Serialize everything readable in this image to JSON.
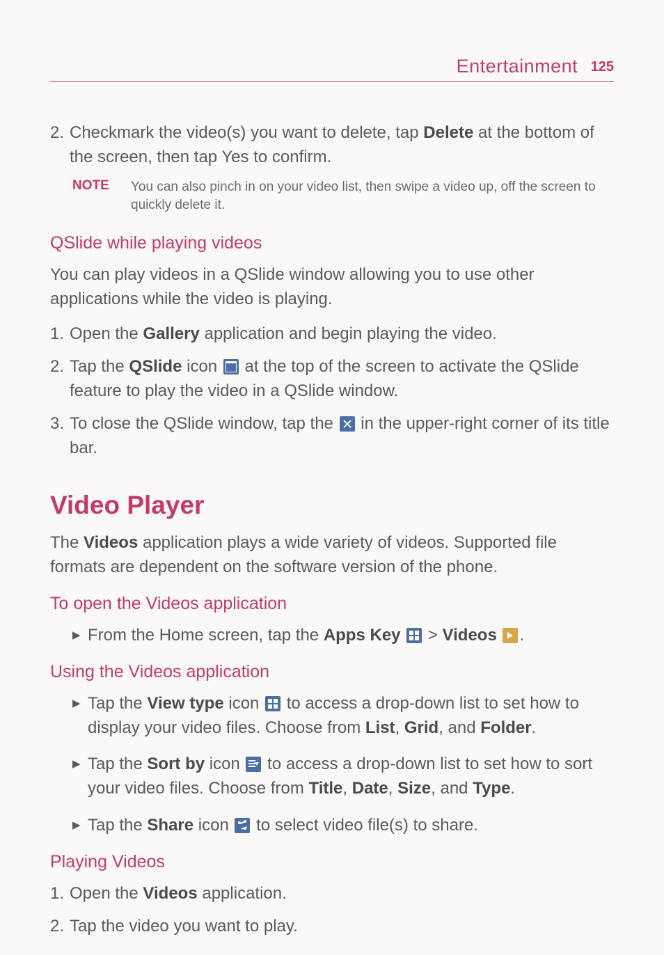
{
  "header": {
    "section": "Entertainment",
    "page": "125"
  },
  "sec1": {
    "item2_num": "2.",
    "item2_a": "Checkmark the video(s) you want to delete, tap ",
    "item2_b": "Delete",
    "item2_c": " at the bottom of the screen, then tap Yes to confirm.",
    "note_label": "NOTE",
    "note_text": "You can also pinch in on your video list, then swipe a video up, off the screen to quickly delete it."
  },
  "sec2": {
    "heading": "QSlide while playing videos",
    "para": "You can play videos in a QSlide window allowing you to use other applications while the video is playing.",
    "i1_num": "1.",
    "i1_a": "Open the ",
    "i1_b": "Gallery",
    "i1_c": " application and begin playing the video.",
    "i2_num": "2.",
    "i2_a": "Tap the ",
    "i2_b": "QSlide",
    "i2_c": " icon ",
    "i2_d": " at the top of the screen to activate the QSlide feature to play the video in a QSlide window.",
    "i3_num": "3.",
    "i3_a": "To close the QSlide window, tap the ",
    "i3_b": " in the upper-right corner of its title bar."
  },
  "sec3": {
    "heading": "Video Player",
    "para_a": "The ",
    "para_b": "Videos",
    "para_c": " application plays a wide variety of videos. Supported file formats are dependent on the software version of the phone."
  },
  "sec4": {
    "heading": "To open the Videos application",
    "b1_a": "From the Home screen, tap the ",
    "b1_b": "Apps Key ",
    "b1_c": " > ",
    "b1_d": "Videos ",
    "b1_e": "."
  },
  "sec5": {
    "heading": "Using the Videos application",
    "b1_a": "Tap the ",
    "b1_b": "View type",
    "b1_c": " icon ",
    "b1_d": " to access a drop-down list to set how to display your video files. Choose from ",
    "b1_e": "List",
    "b1_f": ", ",
    "b1_g": "Grid",
    "b1_h": ", and ",
    "b1_i": "Folder",
    "b1_j": ".",
    "b2_a": "Tap the ",
    "b2_b": "Sort by",
    "b2_c": " icon ",
    "b2_d": " to access a drop-down list to set how to sort your video files. Choose from ",
    "b2_e": "Title",
    "b2_f": ", ",
    "b2_g": "Date",
    "b2_h": ", ",
    "b2_i": "Size",
    "b2_j": ", and ",
    "b2_k": "Type",
    "b2_l": ".",
    "b3_a": "Tap the ",
    "b3_b": "Share",
    "b3_c": " icon ",
    "b3_d": " to select video file(s) to share."
  },
  "sec6": {
    "heading": "Playing Videos",
    "i1_num": "1.",
    "i1_a": "Open the ",
    "i1_b": "Videos",
    "i1_c": " application.",
    "i2_num": "2.",
    "i2_a": "Tap the video you want to play."
  },
  "bullet": "▶"
}
